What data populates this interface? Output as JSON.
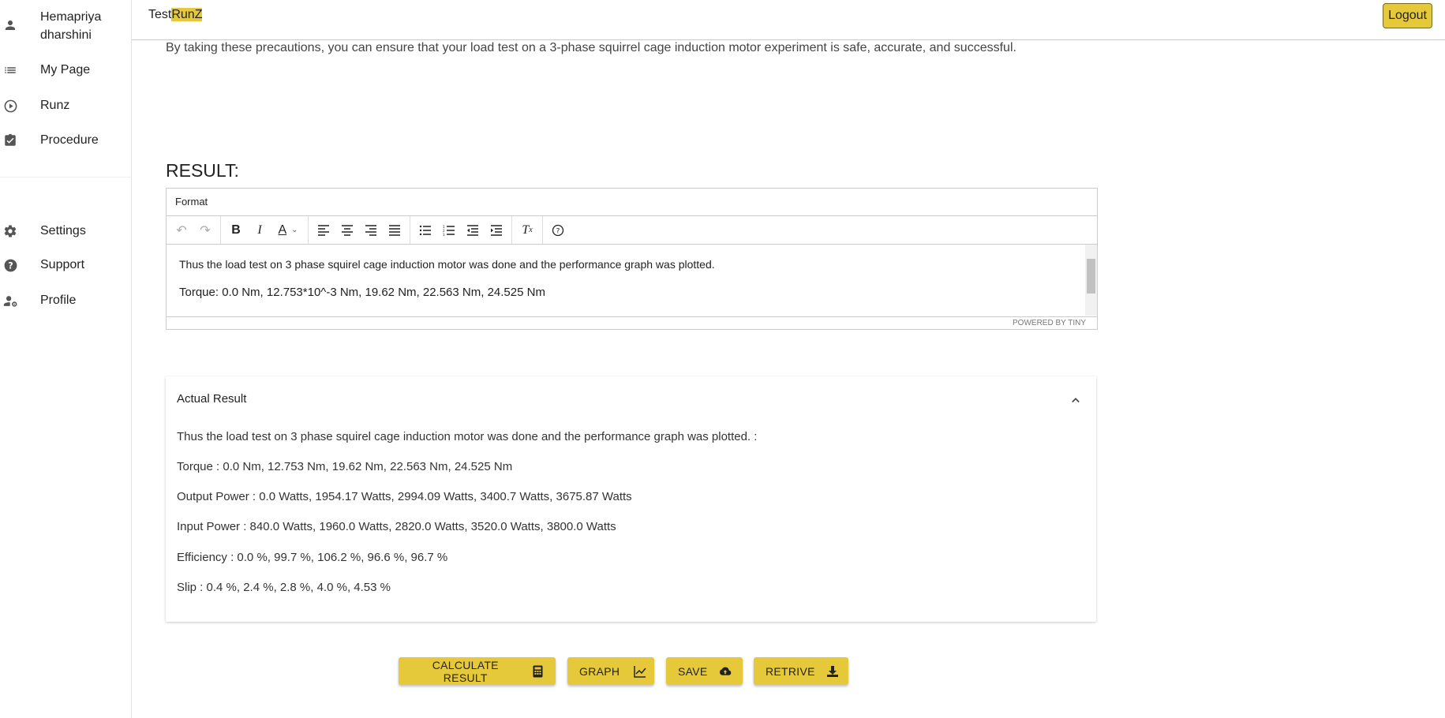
{
  "sidebar": {
    "user": {
      "line1": "Hemapriya",
      "line2": "dharshini"
    },
    "items": [
      {
        "label": "My Page"
      },
      {
        "label": "Runz"
      },
      {
        "label": "Procedure"
      },
      {
        "label": "Settings"
      },
      {
        "label": "Support"
      },
      {
        "label": "Profile"
      }
    ]
  },
  "header": {
    "brand_a": "Test",
    "brand_b": "RunZ",
    "logout_label": "Logout"
  },
  "intro_text": "By taking these precautions, you can ensure that your load test on a 3-phase squirrel cage induction motor experiment is safe, accurate, and successful.",
  "result_title": "RESULT:",
  "editor": {
    "menu_label": "Format",
    "content_line1": "Thus the load test on 3 phase squirel cage induction motor was done and the performance graph was plotted.",
    "content_line2": "Torque: 0.0 Nm, 12.753*10^-3 Nm, 19.62 Nm, 22.563 Nm, 24.525 Nm",
    "powered_by": "POWERED BY TINY"
  },
  "actual_result": {
    "title": "Actual Result",
    "lines": [
      "Thus the load test on 3 phase squirel cage induction motor was done and the performance graph was plotted. :",
      "Torque : 0.0 Nm, 12.753 Nm, 19.62 Nm, 22.563 Nm, 24.525 Nm",
      "Output Power : 0.0 Watts, 1954.17 Watts, 2994.09 Watts, 3400.7 Watts, 3675.87 Watts",
      "Input Power : 840.0 Watts, 1960.0 Watts, 2820.0 Watts, 3520.0 Watts, 3800.0 Watts",
      "Efficiency : 0.0 %, 99.7 %, 106.2 %, 96.6 %, 96.7 %",
      "Slip : 0.4 %, 2.4 %, 2.8 %, 4.0 %, 4.53 %"
    ]
  },
  "buttons": {
    "calculate": "CALCULATE RESULT",
    "graph": "GRAPH",
    "save": "SAVE",
    "retrive": "RETRIVE"
  },
  "colors": {
    "accent": "#e6c93a"
  }
}
